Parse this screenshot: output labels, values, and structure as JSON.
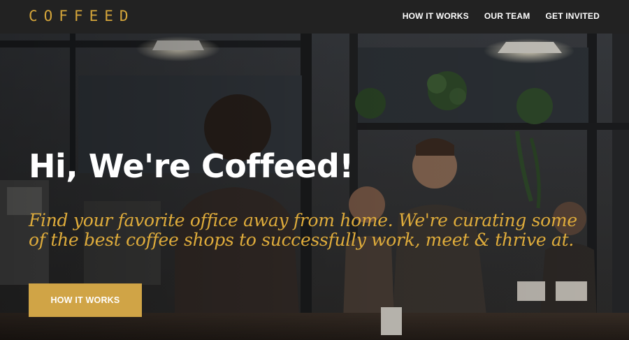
{
  "brand": {
    "logo": "COFFEED",
    "accent_color": "#d4a53a"
  },
  "nav": {
    "items": [
      {
        "label": "HOW IT WORKS"
      },
      {
        "label": "OUR TEAM"
      },
      {
        "label": "GET INVITED"
      }
    ]
  },
  "hero": {
    "background": "coffee-shop-photo",
    "title": "Hi, We're Coffeed!",
    "subtitle": "Find your favorite office away from home. We're curating some of the best coffee shops to successfully work, meet & thrive at.",
    "cta_label": "HOW IT WORKS",
    "cta_color": "#d0a446"
  }
}
